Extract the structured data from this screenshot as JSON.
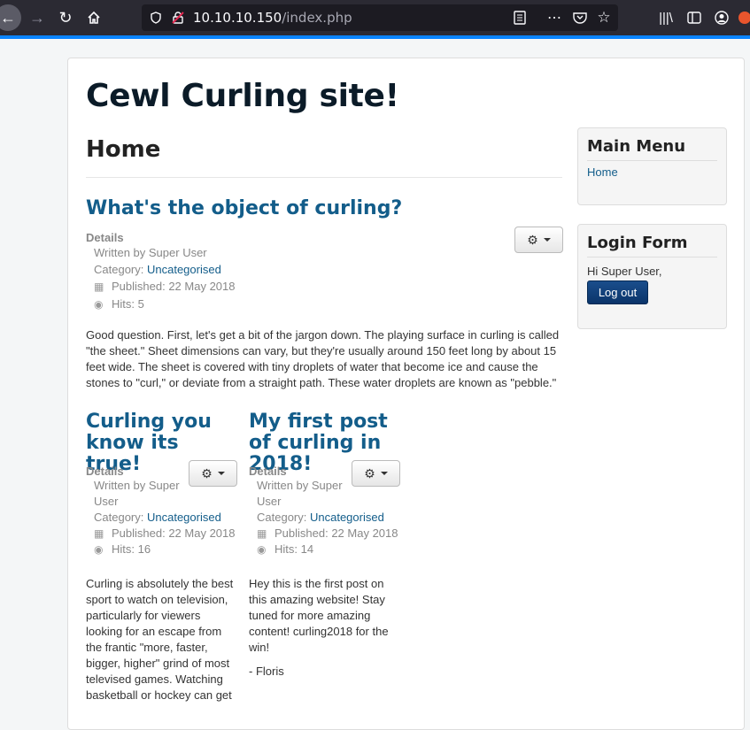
{
  "browser": {
    "url_host": "10.10.10.150",
    "url_path": "/index.php",
    "icons": [
      "back-arrow-icon",
      "forward-arrow-icon",
      "reload-icon",
      "home-icon",
      "shield-icon",
      "insecure-lock-icon",
      "reader-icon",
      "more-icon",
      "pocket-icon",
      "bookmark-star-icon",
      "library-icon",
      "sidebar-icon",
      "account-icon",
      "extension-icon"
    ]
  },
  "site": {
    "title": "Cewl Curling site!",
    "page_heading": "Home"
  },
  "articles": [
    {
      "title": "What's the object of curling?",
      "details_label": "Details",
      "written_by": "Written by Super User",
      "category_prefix": "Category: ",
      "category": "Uncategorised",
      "published": "Published: 22 May 2018",
      "hits": "Hits: 5",
      "body": "Good question. First, let's get a bit of the jargon down. The playing surface in curling is called \"the sheet.\" Sheet dimensions can vary, but they're usually around 150 feet long by about 15 feet wide. The sheet is covered with tiny droplets of water that become ice and cause the stones to \"curl,\" or deviate from a straight path. These water droplets are known as \"pebble.\""
    },
    {
      "title": "Curling you know its true!",
      "details_label": "Details",
      "written_by": "Written by Super User",
      "category_prefix": "Category: ",
      "category": "Uncategorised",
      "published": "Published: 22 May 2018",
      "hits": "Hits: 16",
      "body": "Curling is absolutely the best sport to watch on television, particularly for viewers looking for an escape from the frantic \"more, faster, bigger, higher\" grind of most televised games. Watching basketball or hockey can get"
    },
    {
      "title": "My first post of curling in 2018!",
      "details_label": "Details",
      "written_by": "Written by Super User",
      "category_prefix": "Category: ",
      "category": "Uncategorised",
      "published": "Published: 22 May 2018",
      "hits": "Hits: 14",
      "body": "Hey this is the first post on this amazing website! Stay tuned for more amazing content! curling2018 for the win!",
      "signature": "- Floris"
    }
  ],
  "sidebar": {
    "main_menu": {
      "title": "Main Menu",
      "items": [
        "Home"
      ]
    },
    "login_form": {
      "title": "Login Form",
      "greeting": "Hi Super User,",
      "logout_label": "Log out"
    }
  },
  "colors": {
    "link": "#135d8a",
    "accent": "#0a84ff",
    "logout_button": "#0b356a"
  }
}
